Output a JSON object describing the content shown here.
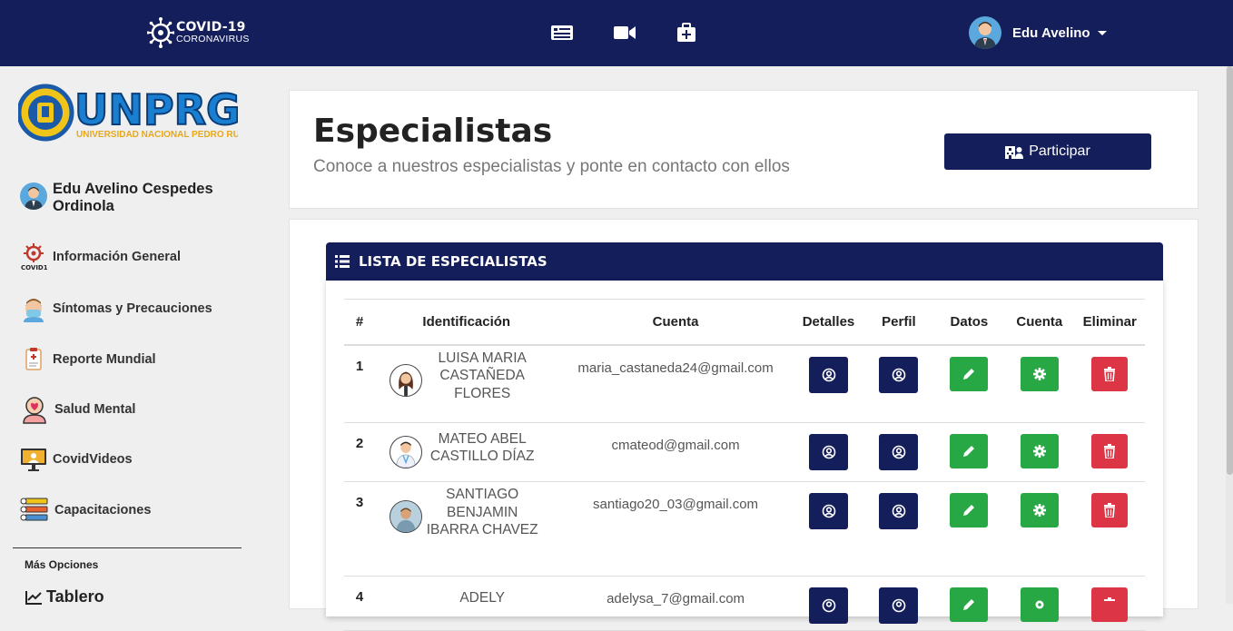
{
  "topbar": {
    "logo_title": "COVID-19",
    "logo_sub": "CORONAVIRUS",
    "nav_icons": [
      "news-icon",
      "video-camera-icon",
      "medical-kit-icon"
    ],
    "user_name": "Edu Avelino"
  },
  "sidebar": {
    "user_name": "Edu Avelino Cespedes Ordinola",
    "items": [
      {
        "label": "Información General",
        "icon": "covid-virus-icon"
      },
      {
        "label": "Síntomas y Precauciones",
        "icon": "masked-person-icon"
      },
      {
        "label": "Reporte Mundial",
        "icon": "report-clipboard-icon"
      },
      {
        "label": "Salud Mental",
        "icon": "mental-health-icon"
      },
      {
        "label": "CovidVideos",
        "icon": "video-monitor-icon"
      },
      {
        "label": "Capacitaciones",
        "icon": "training-steps-icon"
      }
    ],
    "more_options": "Más Opciones",
    "tablero": "Tablero"
  },
  "header": {
    "title": "Especialistas",
    "subtitle": "Conoce a nuestros especialistas y ponte en contacto con ellos",
    "participar": "Participar"
  },
  "list": {
    "title": "LISTA DE ESPECIALISTAS",
    "columns": [
      "#",
      "Identificación",
      "Cuenta",
      "Detalles",
      "Perfil",
      "Datos",
      "Cuenta",
      "Eliminar"
    ],
    "rows": [
      {
        "num": "1",
        "name": "LUISA MARIA CASTAÑEDA FLORES",
        "email": "maria_castaneda24@gmail.com"
      },
      {
        "num": "2",
        "name": "MATEO ABEL CASTILLO DÍAZ",
        "email": "cmateod@gmail.com"
      },
      {
        "num": "3",
        "name": "SANTIAGO BENJAMIN IBARRA CHAVEZ",
        "email": "santiago20_03@gmail.com"
      },
      {
        "num": "4",
        "name": "ADELY",
        "email": "adelysa_7@gmail.com"
      }
    ]
  },
  "colors": {
    "primary": "#141e5a",
    "success": "#28a745",
    "danger": "#dc3545"
  }
}
